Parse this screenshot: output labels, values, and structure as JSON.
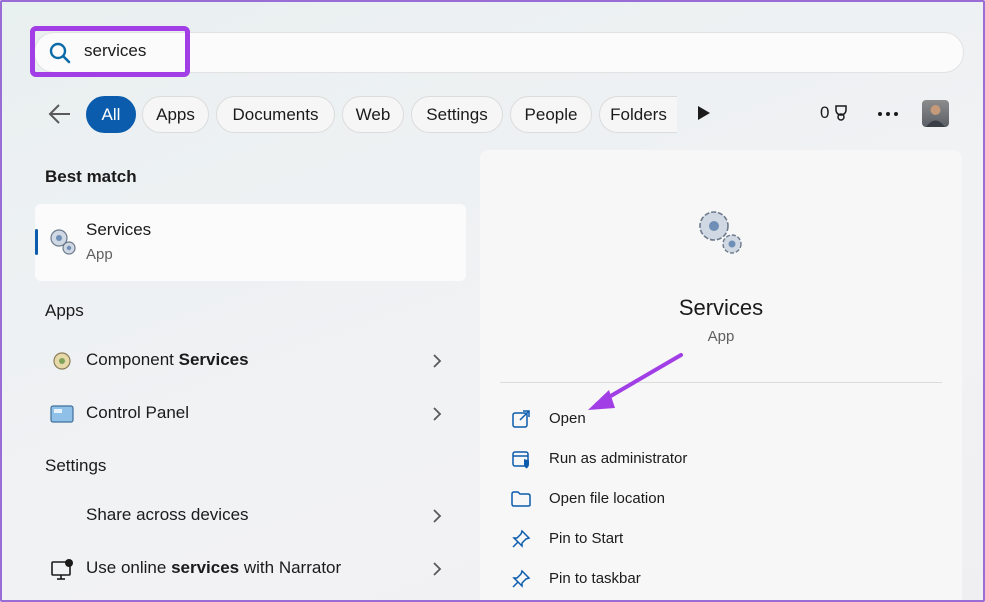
{
  "search": {
    "query": "services"
  },
  "filters": {
    "tabs": [
      {
        "label": "All"
      },
      {
        "label": "Apps"
      },
      {
        "label": "Documents"
      },
      {
        "label": "Web"
      },
      {
        "label": "Settings"
      },
      {
        "label": "People"
      },
      {
        "label": "Folders"
      }
    ],
    "points": "0"
  },
  "best_match": {
    "heading": "Best match",
    "title": "Services",
    "subtitle": "App"
  },
  "apps": {
    "heading": "Apps",
    "items": [
      {
        "prefix": "Component ",
        "bold": "Services",
        "suffix": ""
      },
      {
        "prefix": "Control Panel",
        "bold": "",
        "suffix": ""
      }
    ]
  },
  "settings": {
    "heading": "Settings",
    "items": [
      {
        "prefix": "Share across devices",
        "bold": "",
        "suffix": ""
      },
      {
        "prefix": "Use online ",
        "bold": "services",
        "suffix": " with Narrator"
      }
    ]
  },
  "detail": {
    "title": "Services",
    "subtitle": "App",
    "actions": [
      {
        "label": "Open"
      },
      {
        "label": "Run as administrator"
      },
      {
        "label": "Open file location"
      },
      {
        "label": "Pin to Start"
      },
      {
        "label": "Pin to taskbar"
      }
    ]
  },
  "colors": {
    "accent": "#0b5cad",
    "highlight": "#a23ee6"
  }
}
